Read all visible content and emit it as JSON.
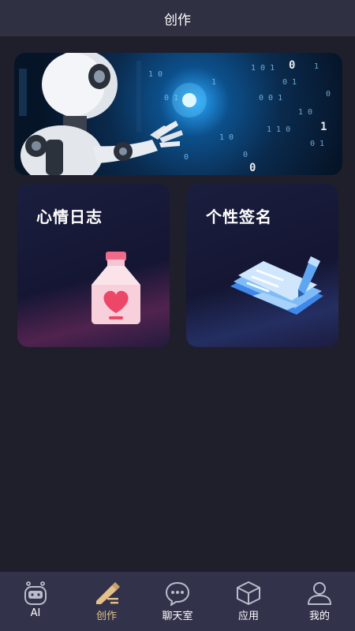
{
  "header": {
    "title": "创作"
  },
  "banner": {
    "alt_icon": "robot-hand-image"
  },
  "cards": [
    {
      "title": "心情日志",
      "icon": "heart-bottle-icon"
    },
    {
      "title": "个性签名",
      "icon": "pen-notepad-icon"
    }
  ],
  "tabs": [
    {
      "label": "AI",
      "icon": "robot-icon",
      "active": false
    },
    {
      "label": "创作",
      "icon": "pen-write-icon",
      "active": true
    },
    {
      "label": "聊天室",
      "icon": "chat-bubble-icon",
      "active": false
    },
    {
      "label": "应用",
      "icon": "box-icon",
      "active": false
    },
    {
      "label": "我的",
      "icon": "user-icon",
      "active": false
    }
  ],
  "colors": {
    "background": "#1f1f2b",
    "header": "#2f3042",
    "tabbar": "#32334a",
    "accent": "#e4c08a"
  }
}
